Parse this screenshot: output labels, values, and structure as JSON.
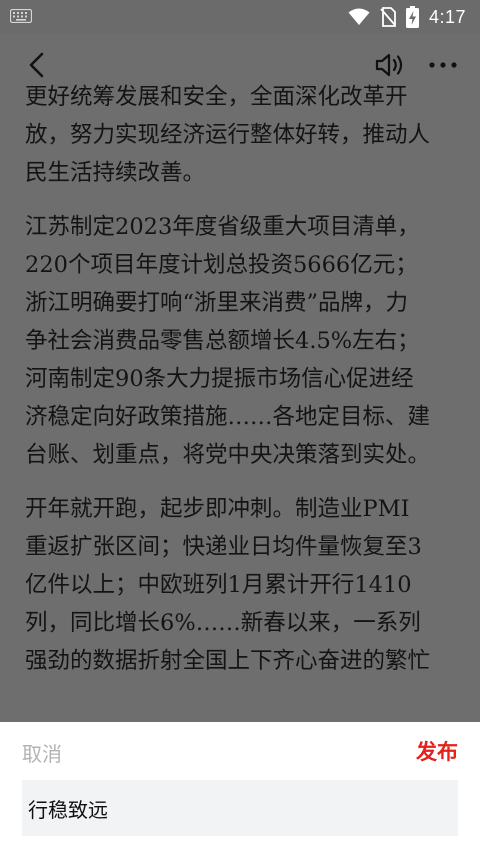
{
  "status_bar": {
    "time": "4:17",
    "icons": [
      "keyboard-icon",
      "wifi-icon",
      "no-sim-icon",
      "battery-charging-icon"
    ]
  },
  "top_bar": {
    "icons": [
      "back-icon",
      "speaker-icon",
      "more-icon"
    ]
  },
  "article": {
    "lines": [
      "更好统筹发展和安全，全面深化改革开",
      "放，努力实现经济运行整体好转，推动人",
      "民生活持续改善。",
      "",
      "江苏制定2023年度省级重大项目清单，",
      "220个项目年度计划总投资5666亿元；",
      "浙江明确要打响“浙里来消费”品牌，力",
      "争社会消费品零售总额增长4.5%左右；",
      "河南制定90条大力提振市场信心促进经",
      "济稳定向好政策措施……各地定目标、建",
      "台账、划重点，将党中央决策落到实处。",
      "",
      "开年就开跑，起步即冲刺。制造业PMI",
      "重返扩张区间；快递业日均件量恢复至3",
      "亿件以上；中欧班列1月累计开行1410",
      "列，同比增长6%……新春以来，一系列",
      "强劲的数据折射全国上下齐心奋进的繁忙"
    ]
  },
  "comment_sheet": {
    "cancel_label": "取消",
    "publish_label": "发布",
    "input_value": "行稳致远"
  },
  "colors": {
    "overlay": "#6e6e6e",
    "publish": "#e4211a",
    "cancel": "#b3b3b3",
    "input_bg": "#f2f3f5"
  }
}
